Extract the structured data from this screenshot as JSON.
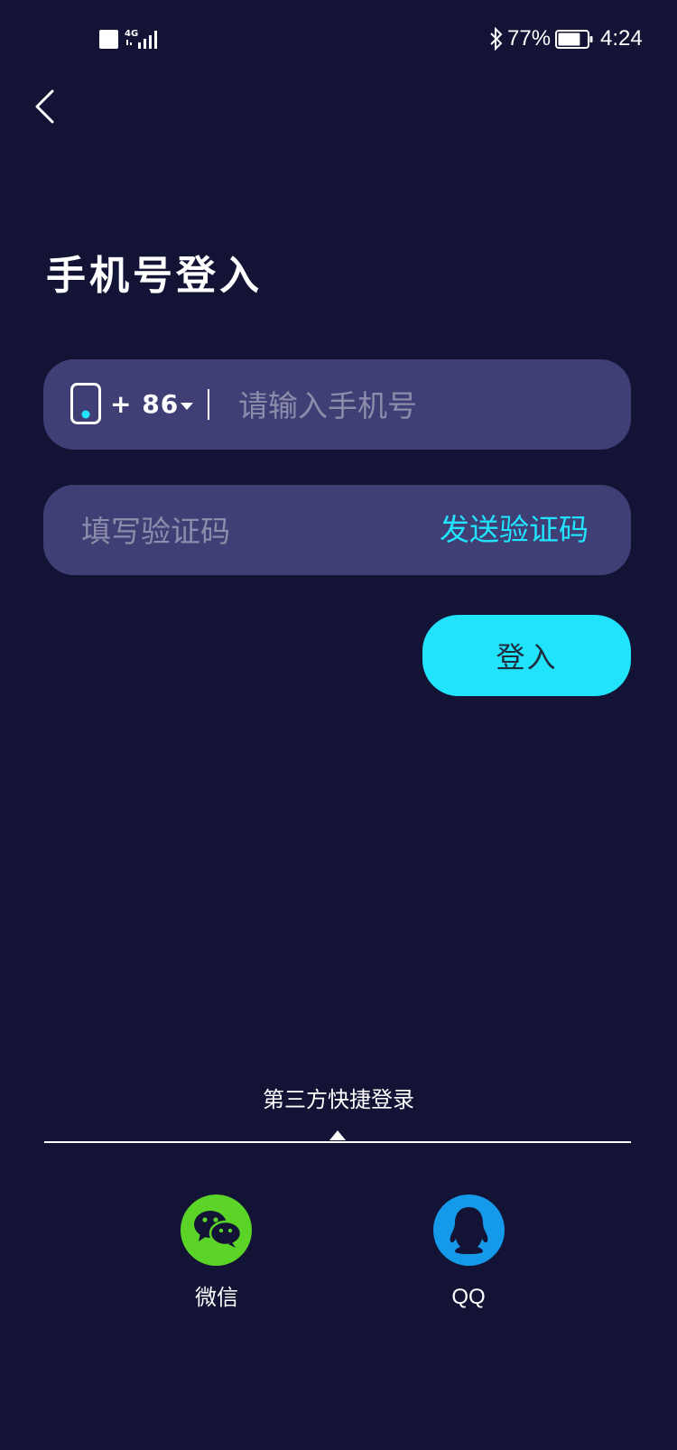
{
  "status_bar": {
    "network_label": "4G",
    "battery_percent": "77%",
    "battery_level": 0.77,
    "time": "4:24"
  },
  "header": {
    "back_icon": "chevron-left-icon"
  },
  "page": {
    "title": "手机号登入"
  },
  "phone_field": {
    "icon": "phone-icon",
    "country_code": "+ 86",
    "placeholder": "请输入手机号",
    "value": ""
  },
  "code_field": {
    "placeholder": "填写验证码",
    "value": "",
    "send_label": "发送验证码"
  },
  "login_button": {
    "label": "登入"
  },
  "third_party": {
    "title": "第三方快捷登录",
    "options": [
      {
        "label": "微信",
        "icon": "wechat-icon",
        "color": "#5cd427"
      },
      {
        "label": "QQ",
        "icon": "qq-icon",
        "color": "#159ae9"
      }
    ]
  },
  "colors": {
    "background": "#131336",
    "field": "#3f3f76",
    "accent": "#21e3fc",
    "placeholder": "#8c8cab"
  }
}
